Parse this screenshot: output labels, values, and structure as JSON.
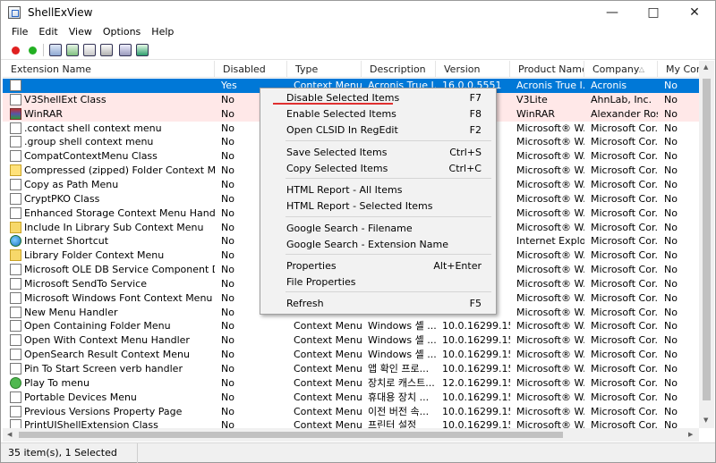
{
  "window": {
    "title": "ShellExView"
  },
  "menu": [
    "File",
    "Edit",
    "View",
    "Options",
    "Help"
  ],
  "columns": [
    "Extension Name",
    "Disabled",
    "Type",
    "Description",
    "Version",
    "Product Name",
    "Company",
    "My Com"
  ],
  "rows": [
    {
      "name": "",
      "disabled": "Yes",
      "type": "Context Menu",
      "desc": "Acronis True I...",
      "version": "16.0.0.5551",
      "product": "Acronis True I...",
      "company": "Acronis",
      "my": "No",
      "icon": "blank"
    },
    {
      "name": "V3ShellExt Class",
      "disabled": "No",
      "type": "",
      "desc": "",
      "version": "",
      "product": "V3Lite",
      "company": "AhnLab, Inc.",
      "my": "No",
      "icon": "blank"
    },
    {
      "name": "WinRAR",
      "disabled": "No",
      "type": "",
      "desc": "",
      "version": "",
      "product": "WinRAR",
      "company": "Alexander Ros...",
      "my": "No",
      "icon": "rar"
    },
    {
      "name": ".contact shell context menu",
      "disabled": "No",
      "type": "",
      "desc": "",
      "version": "",
      "product": "Microsoft® W...",
      "company": "Microsoft Cor...",
      "my": "No",
      "icon": "blank"
    },
    {
      "name": ".group shell context menu",
      "disabled": "No",
      "type": "",
      "desc": "",
      "version": "",
      "product": "Microsoft® W...",
      "company": "Microsoft Cor...",
      "my": "No",
      "icon": "blank"
    },
    {
      "name": "CompatContextMenu Class",
      "disabled": "No",
      "type": "",
      "desc": "",
      "version": "",
      "product": "Microsoft® W...",
      "company": "Microsoft Cor...",
      "my": "No",
      "icon": "blank"
    },
    {
      "name": "Compressed (zipped) Folder Context Menu",
      "disabled": "No",
      "type": "",
      "desc": "",
      "version": "",
      "product": "Microsoft® W...",
      "company": "Microsoft Cor...",
      "my": "No",
      "icon": "yellow"
    },
    {
      "name": "Copy as Path Menu",
      "disabled": "No",
      "type": "",
      "desc": "",
      "version": "",
      "product": "Microsoft® W...",
      "company": "Microsoft Cor...",
      "my": "No",
      "icon": "blank"
    },
    {
      "name": "CryptPKO Class",
      "disabled": "No",
      "type": "",
      "desc": "",
      "version": "",
      "product": "Microsoft® W...",
      "company": "Microsoft Cor...",
      "my": "No",
      "icon": "blank"
    },
    {
      "name": "Enhanced Storage Context Menu Handler Cl...",
      "disabled": "No",
      "type": "",
      "desc": "",
      "version": "",
      "product": "Microsoft® W...",
      "company": "Microsoft Cor...",
      "my": "No",
      "icon": "blank"
    },
    {
      "name": "Include In Library Sub Context Menu",
      "disabled": "No",
      "type": "",
      "desc": "",
      "version": "",
      "product": "Microsoft® W...",
      "company": "Microsoft Cor...",
      "my": "No",
      "icon": "folder"
    },
    {
      "name": "Internet Shortcut",
      "disabled": "No",
      "type": "",
      "desc": "",
      "version": "",
      "product": "Internet Explorer",
      "company": "Microsoft Cor...",
      "my": "No",
      "icon": "globe"
    },
    {
      "name": "Library Folder Context Menu",
      "disabled": "No",
      "type": "",
      "desc": "",
      "version": "",
      "product": "Microsoft® W...",
      "company": "Microsoft Cor...",
      "my": "No",
      "icon": "folder"
    },
    {
      "name": "Microsoft OLE DB Service Component Data ...",
      "disabled": "No",
      "type": "",
      "desc": "",
      "version": "",
      "product": "Microsoft® W...",
      "company": "Microsoft Cor...",
      "my": "No",
      "icon": "blank"
    },
    {
      "name": "Microsoft SendTo Service",
      "disabled": "No",
      "type": "",
      "desc": "",
      "version": "",
      "product": "Microsoft® W...",
      "company": "Microsoft Cor...",
      "my": "No",
      "icon": "blank"
    },
    {
      "name": "Microsoft Windows Font Context Menu Han...",
      "disabled": "No",
      "type": "",
      "desc": "",
      "version": "",
      "product": "Microsoft® W...",
      "company": "Microsoft Cor...",
      "my": "No",
      "icon": "blank"
    },
    {
      "name": "New Menu Handler",
      "disabled": "No",
      "type": "",
      "desc": "",
      "version": "",
      "product": "Microsoft® W...",
      "company": "Microsoft Cor...",
      "my": "No",
      "icon": "blank"
    },
    {
      "name": "Open Containing Folder Menu",
      "disabled": "No",
      "type": "Context Menu",
      "desc": "Windows 셸 ...",
      "version": "10.0.16299.15...",
      "product": "Microsoft® W...",
      "company": "Microsoft Cor...",
      "my": "No",
      "icon": "blank"
    },
    {
      "name": "Open With Context Menu Handler",
      "disabled": "No",
      "type": "Context Menu",
      "desc": "Windows 셸 ...",
      "version": "10.0.16299.15...",
      "product": "Microsoft® W...",
      "company": "Microsoft Cor...",
      "my": "No",
      "icon": "blank"
    },
    {
      "name": "OpenSearch Result Context Menu",
      "disabled": "No",
      "type": "Context Menu",
      "desc": "Windows 셸 ...",
      "version": "10.0.16299.15...",
      "product": "Microsoft® W...",
      "company": "Microsoft Cor...",
      "my": "No",
      "icon": "blank"
    },
    {
      "name": "Pin To Start Screen verb handler",
      "disabled": "No",
      "type": "Context Menu",
      "desc": "앱 확인 프로...",
      "version": "10.0.16299.15...",
      "product": "Microsoft® W...",
      "company": "Microsoft Cor...",
      "my": "No",
      "icon": "blank"
    },
    {
      "name": "Play To menu",
      "disabled": "No",
      "type": "Context Menu",
      "desc": "장치로 캐스트...",
      "version": "12.0.16299.15...",
      "product": "Microsoft® W...",
      "company": "Microsoft Cor...",
      "my": "No",
      "icon": "green"
    },
    {
      "name": "Portable Devices Menu",
      "disabled": "No",
      "type": "Context Menu",
      "desc": "휴대용 장치 ...",
      "version": "10.0.16299.15...",
      "product": "Microsoft® W...",
      "company": "Microsoft Cor...",
      "my": "No",
      "icon": "blank"
    },
    {
      "name": "Previous Versions Property Page",
      "disabled": "No",
      "type": "Context Menu",
      "desc": "이전 버전 속...",
      "version": "10.0.16299.15...",
      "product": "Microsoft® W...",
      "company": "Microsoft Cor...",
      "my": "No",
      "icon": "blank"
    },
    {
      "name": "PrintUIShellExtension Class",
      "disabled": "No",
      "type": "Context Menu",
      "desc": "프린터 설정",
      "version": "10.0.16299.15...",
      "product": "Microsoft® W...",
      "company": "Microsoft Cor...",
      "my": "No",
      "icon": "blank"
    }
  ],
  "context_menu": {
    "items": [
      {
        "label": "Disable Selected Items",
        "shortcut": "F7"
      },
      {
        "label": "Enable Selected Items",
        "shortcut": "F8"
      },
      {
        "label": "Open CLSID In RegEdit",
        "shortcut": "F2"
      },
      {
        "label": "Save Selected Items",
        "shortcut": "Ctrl+S"
      },
      {
        "label": "Copy Selected Items",
        "shortcut": "Ctrl+C"
      },
      {
        "label": "HTML Report - All Items",
        "shortcut": ""
      },
      {
        "label": "HTML Report - Selected Items",
        "shortcut": ""
      },
      {
        "label": "Google Search - Filename",
        "shortcut": ""
      },
      {
        "label": "Google Search - Extension Name",
        "shortcut": ""
      },
      {
        "label": "Properties",
        "shortcut": "Alt+Enter"
      },
      {
        "label": "File Properties",
        "shortcut": ""
      },
      {
        "label": "Refresh",
        "shortcut": "F5"
      }
    ]
  },
  "status": {
    "text": "35 item(s), 1 Selected"
  },
  "colors": {
    "selection": "#0078d7",
    "highlight_row": "#ffe8e8",
    "annotation": "#e03030"
  }
}
